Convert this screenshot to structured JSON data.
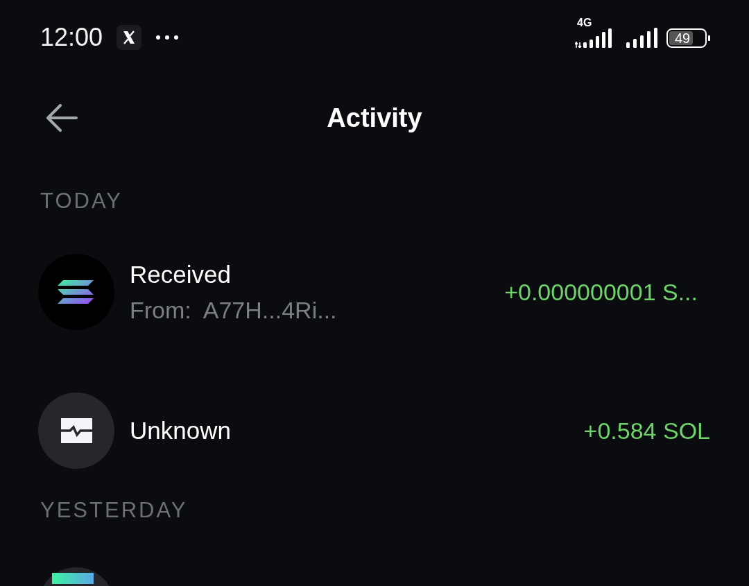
{
  "status_bar": {
    "time": "12:00",
    "notifications": [
      {
        "kind": "x"
      },
      {
        "kind": "more"
      }
    ],
    "network": "4G",
    "battery": "49"
  },
  "header": {
    "title": "Activity"
  },
  "sections": [
    {
      "label": "TODAY",
      "items": [
        {
          "kind": "sol",
          "title": "Received",
          "subtitle": "From:  A77H...4Ri...",
          "amount": "+0.000000001 S..."
        },
        {
          "kind": "unknown",
          "title": "Unknown",
          "amount": "+0.584 SOL"
        }
      ]
    },
    {
      "label": "YESTERDAY",
      "items": [
        {
          "kind": "app"
        }
      ]
    }
  ]
}
